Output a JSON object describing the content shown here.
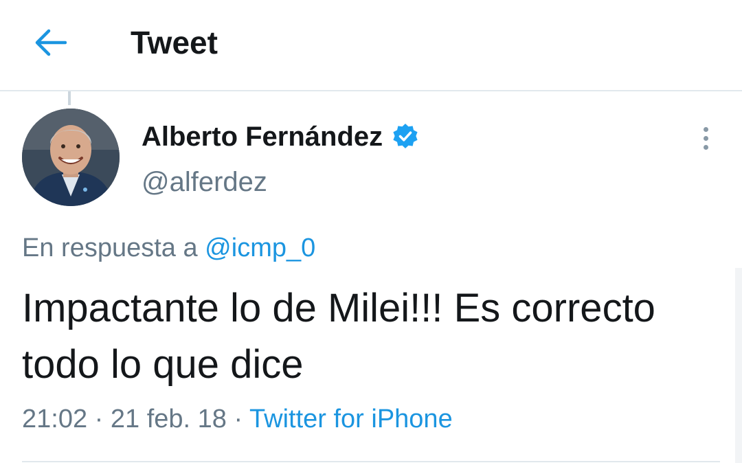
{
  "header": {
    "back_icon": "arrow-left-icon",
    "title": "Tweet"
  },
  "tweet": {
    "author": {
      "name": "Alberto Fernández",
      "handle": "@alferdez",
      "verified": true,
      "verified_icon": "verified-badge-icon"
    },
    "reply": {
      "prefix": "En respuesta a",
      "mention": "@icmp_0"
    },
    "text": "Impactante lo de Milei!!! Es correcto todo lo que dice",
    "meta": {
      "time": "21:02",
      "separator": "·",
      "date": "21 feb. 18",
      "source": "Twitter for iPhone"
    },
    "more_icon": "more-vertical-icon"
  },
  "colors": {
    "accent": "#1b95e0",
    "secondary_text": "#657786",
    "primary_text": "#14171a",
    "border": "#e1e8ed"
  }
}
